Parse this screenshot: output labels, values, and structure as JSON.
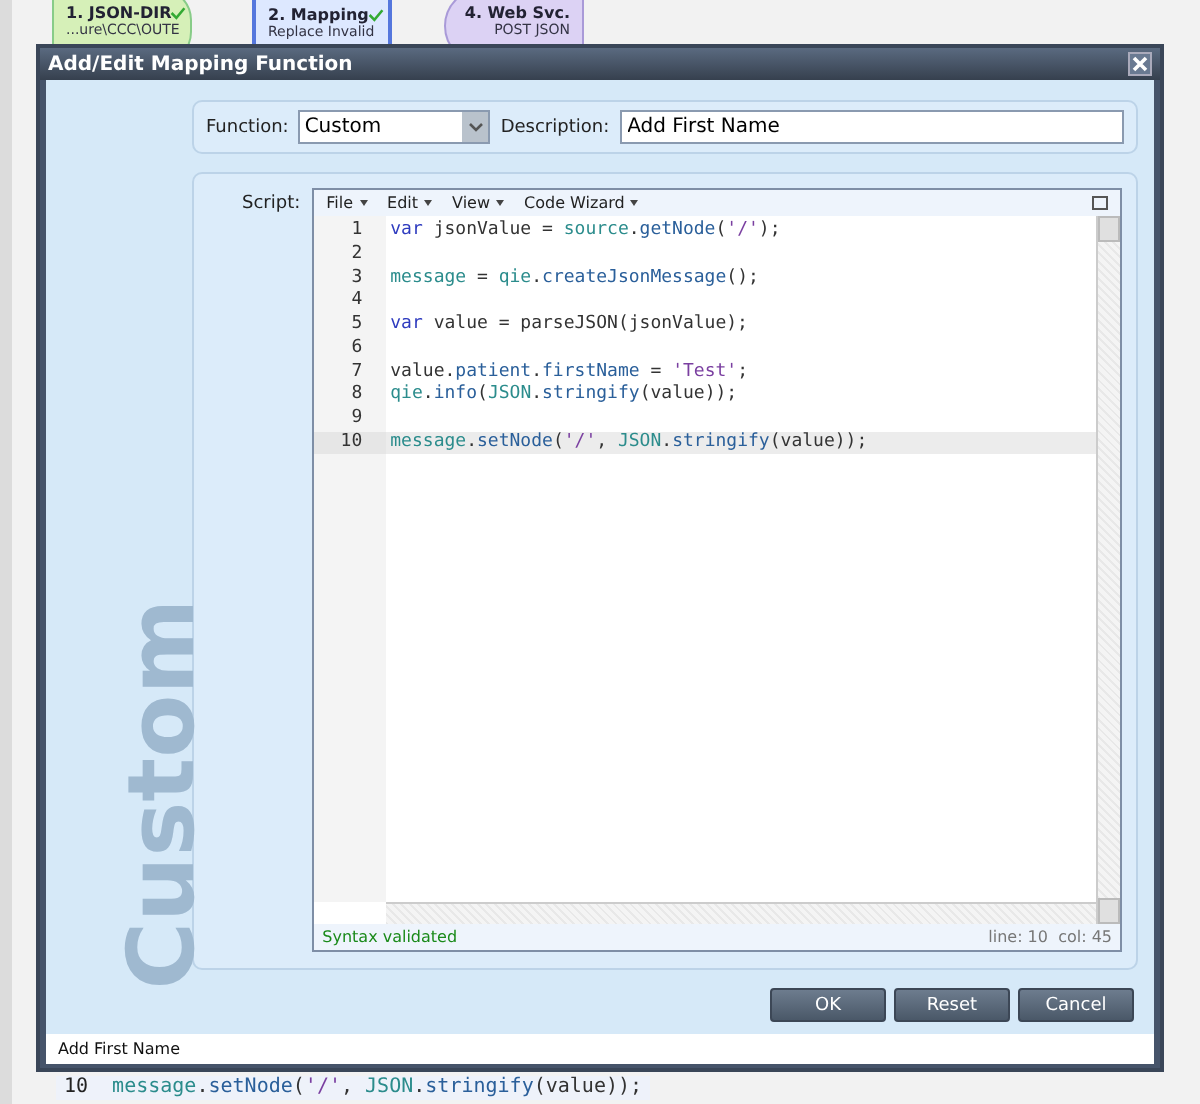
{
  "background": {
    "nodes": [
      {
        "kind": "source",
        "title": "1. JSON-DIR",
        "subtitle": "...ure\\CCC\\OUTE",
        "checked": true
      },
      {
        "kind": "mapping",
        "title": "2. Mapping",
        "subtitle": "Replace Invalid",
        "checked": true
      },
      {
        "kind": "service",
        "title": "4. Web Svc.",
        "subtitle": "POST JSON",
        "checked": false
      }
    ],
    "code_line": {
      "number": "10",
      "tokens": [
        {
          "kind": "obj",
          "text": "message"
        },
        {
          "kind": "plain",
          "text": "."
        },
        {
          "kind": "method",
          "text": "setNode"
        },
        {
          "kind": "plain",
          "text": "("
        },
        {
          "kind": "str",
          "text": "'/'"
        },
        {
          "kind": "plain",
          "text": ", "
        },
        {
          "kind": "obj",
          "text": "JSON"
        },
        {
          "kind": "plain",
          "text": "."
        },
        {
          "kind": "method",
          "text": "stringify"
        },
        {
          "kind": "plain",
          "text": "(value));"
        }
      ]
    }
  },
  "dialog": {
    "title": "Add/Edit Mapping Function",
    "watermark": "Custom",
    "function": {
      "label": "Function:",
      "value": "Custom"
    },
    "description": {
      "label": "Description:",
      "value": "Add First Name"
    },
    "script": {
      "label": "Script:",
      "menus": [
        "File",
        "Edit",
        "View",
        "Code Wizard"
      ],
      "lines": [
        {
          "number": "1",
          "selected": false,
          "tokens": [
            {
              "kind": "kw",
              "text": "var"
            },
            {
              "kind": "plain",
              "text": " jsonValue = "
            },
            {
              "kind": "obj",
              "text": "source"
            },
            {
              "kind": "plain",
              "text": "."
            },
            {
              "kind": "method",
              "text": "getNode"
            },
            {
              "kind": "plain",
              "text": "("
            },
            {
              "kind": "str",
              "text": "'/'"
            },
            {
              "kind": "plain",
              "text": ");"
            }
          ]
        },
        {
          "number": "2",
          "selected": false
        },
        {
          "number": "3",
          "selected": false,
          "tokens": [
            {
              "kind": "obj",
              "text": "message"
            },
            {
              "kind": "plain",
              "text": " = "
            },
            {
              "kind": "obj",
              "text": "qie"
            },
            {
              "kind": "plain",
              "text": "."
            },
            {
              "kind": "method",
              "text": "createJsonMessage"
            },
            {
              "kind": "plain",
              "text": "();"
            }
          ]
        },
        {
          "number": "4",
          "selected": false
        },
        {
          "number": "5",
          "selected": false,
          "tokens": [
            {
              "kind": "kw",
              "text": "var"
            },
            {
              "kind": "plain",
              "text": " value = parseJSON(jsonValue);"
            }
          ]
        },
        {
          "number": "6",
          "selected": false
        },
        {
          "number": "7",
          "selected": false,
          "tokens": [
            {
              "kind": "plain",
              "text": "value."
            },
            {
              "kind": "method",
              "text": "patient"
            },
            {
              "kind": "plain",
              "text": "."
            },
            {
              "kind": "method",
              "text": "firstName"
            },
            {
              "kind": "plain",
              "text": " = "
            },
            {
              "kind": "str",
              "text": "'Test'"
            },
            {
              "kind": "plain",
              "text": ";"
            }
          ]
        },
        {
          "number": "8",
          "selected": false,
          "tokens": [
            {
              "kind": "obj",
              "text": "qie"
            },
            {
              "kind": "plain",
              "text": "."
            },
            {
              "kind": "method",
              "text": "info"
            },
            {
              "kind": "plain",
              "text": "("
            },
            {
              "kind": "obj",
              "text": "JSON"
            },
            {
              "kind": "plain",
              "text": "."
            },
            {
              "kind": "method",
              "text": "stringify"
            },
            {
              "kind": "plain",
              "text": "(value));"
            }
          ]
        },
        {
          "number": "9",
          "selected": false
        },
        {
          "number": "10",
          "selected": true,
          "tokens": [
            {
              "kind": "obj",
              "text": "message"
            },
            {
              "kind": "plain",
              "text": "."
            },
            {
              "kind": "method",
              "text": "setNode"
            },
            {
              "kind": "plain",
              "text": "("
            },
            {
              "kind": "str",
              "text": "'/'"
            },
            {
              "kind": "plain",
              "text": ", "
            },
            {
              "kind": "obj",
              "text": "JSON"
            },
            {
              "kind": "plain",
              "text": "."
            },
            {
              "kind": "method",
              "text": "stringify"
            },
            {
              "kind": "plain",
              "text": "(value));"
            }
          ]
        }
      ],
      "status": "Syntax validated",
      "position": "line: 10  col: 45"
    },
    "buttons": [
      "OK",
      "Reset",
      "Cancel"
    ],
    "footer": "Add First Name"
  }
}
